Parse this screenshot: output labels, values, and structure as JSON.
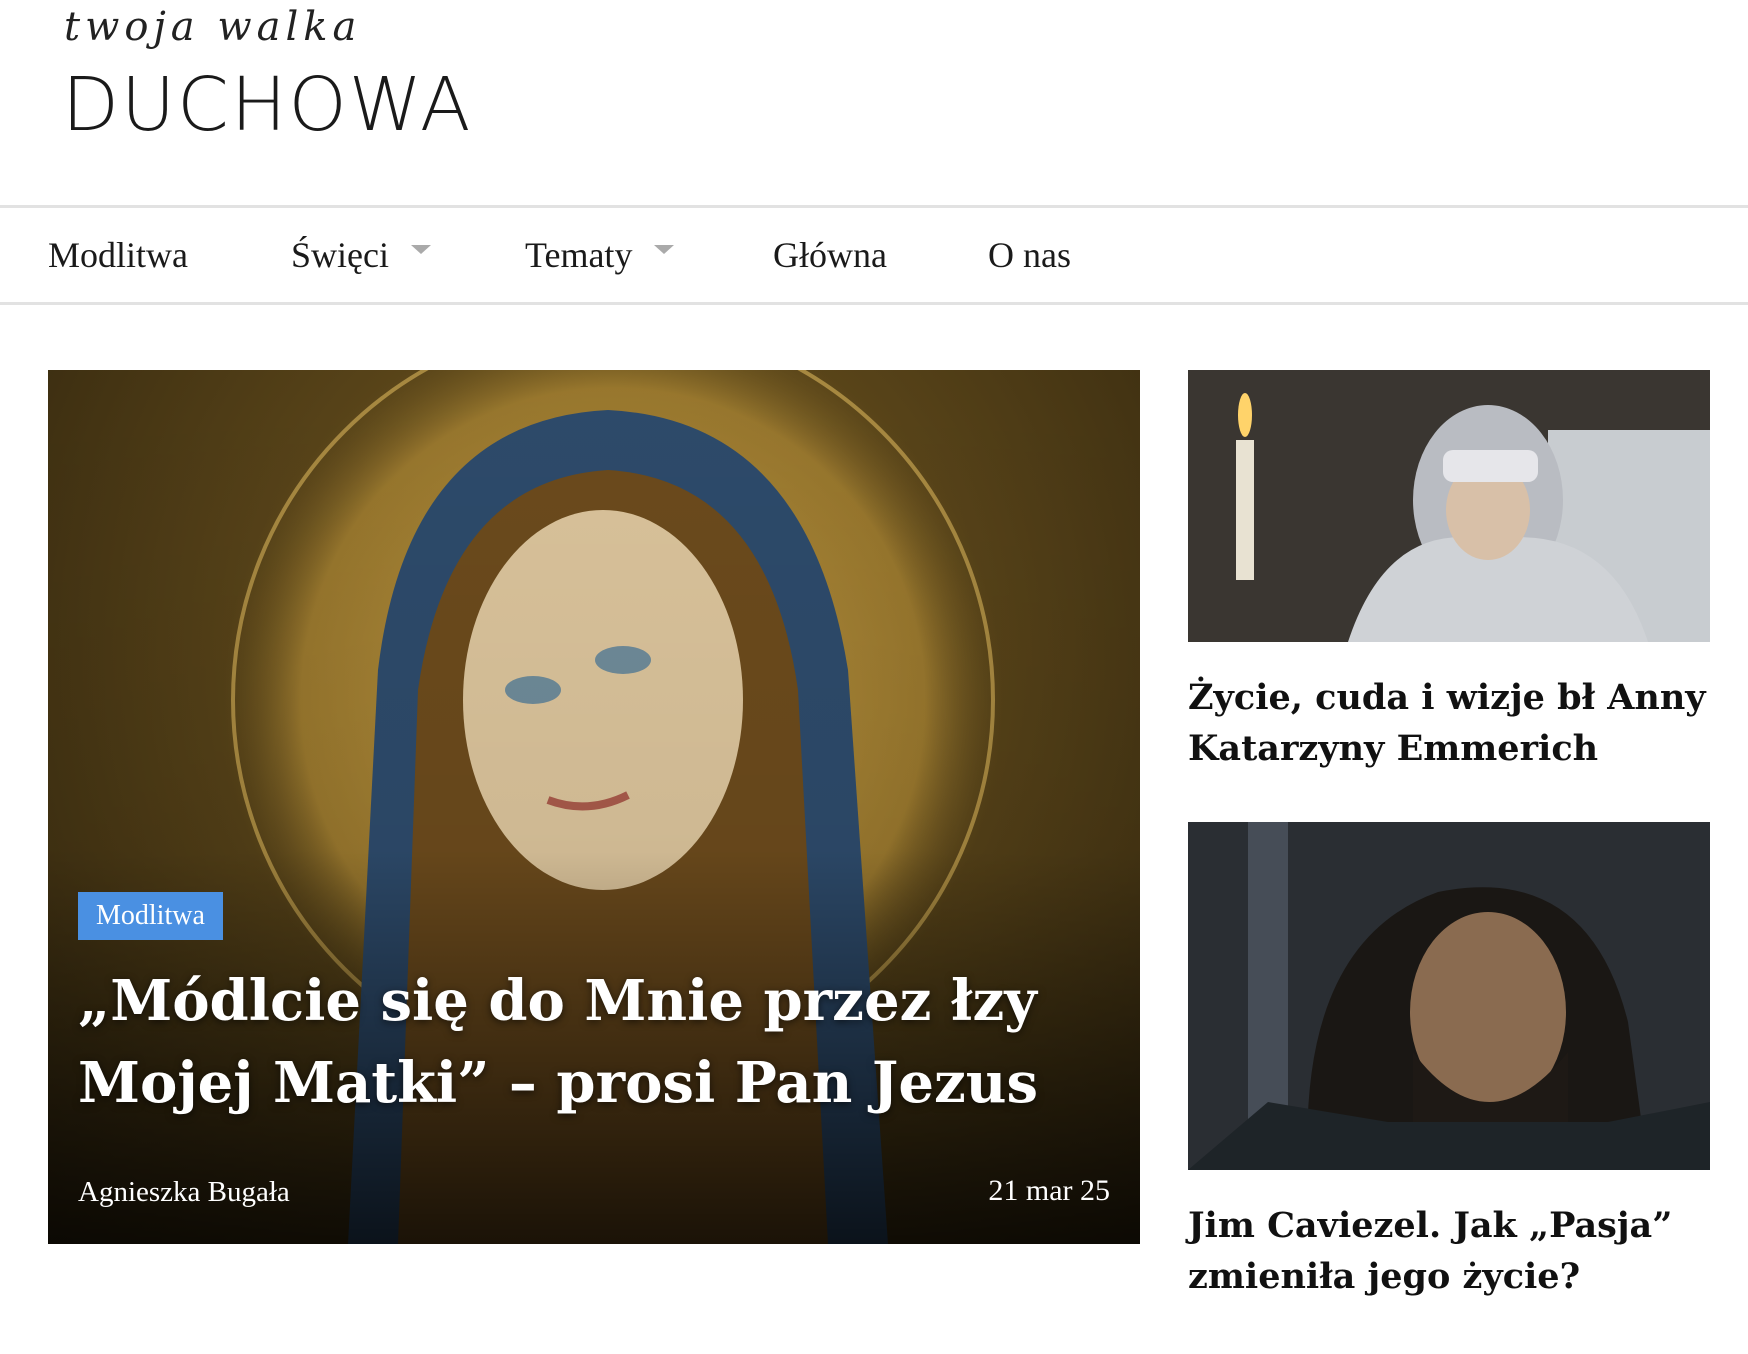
{
  "logo": {
    "script": "twoja walka",
    "main": "DUCHOWA"
  },
  "nav": {
    "items": [
      {
        "label": "Modlitwa",
        "dropdown": false
      },
      {
        "label": "Święci",
        "dropdown": true
      },
      {
        "label": "Tematy",
        "dropdown": true
      },
      {
        "label": "Główna",
        "dropdown": false
      },
      {
        "label": "O nas",
        "dropdown": false
      }
    ]
  },
  "featured": {
    "category": "Modlitwa",
    "title": "„Módlcie się do Mnie przez łzy Mojej Matki” – prosi Pan Jezus",
    "author": "Agnieszka Bugała",
    "date": "21 mar 25",
    "badge_color": "#4a90e2"
  },
  "side_articles": [
    {
      "title": "Życie, cuda i wizje bł Anny Katarzyny Emmerich"
    },
    {
      "title": "Jim Caviezel. Jak „Pasja” zmieniła jego życie?"
    }
  ]
}
